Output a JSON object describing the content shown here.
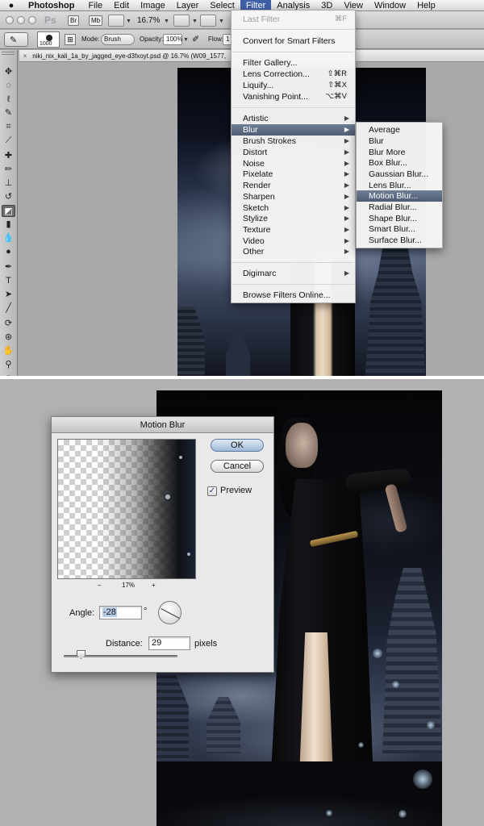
{
  "menubar": {
    "items": [
      "Photoshop",
      "File",
      "Edit",
      "Image",
      "Layer",
      "Select",
      "Filter",
      "Analysis",
      "3D",
      "View",
      "Window",
      "Help"
    ]
  },
  "appbar": {
    "logo": "Ps",
    "bridge": "Br",
    "minibridge": "Mb",
    "zoom": "16.7%"
  },
  "options": {
    "brush_size": "1000",
    "mode_label": "Mode:",
    "mode_value": "Brush",
    "opacity_label": "Opacity:",
    "opacity_value": "100%",
    "flow_label": "Flow:",
    "flow_value": "1"
  },
  "document_tab": {
    "close": "×",
    "title": "niki_nix_kali_1a_by_jagged_eye-d3fxoyt.psd @ 16.7% (W09_1577,"
  },
  "filter_menu": {
    "last_filter": "Last Filter",
    "last_filter_shortcut": "⌘F",
    "convert": "Convert for Smart Filters",
    "gallery": "Filter Gallery...",
    "lens_correction": "Lens Correction...",
    "lens_correction_shortcut": "⇧⌘R",
    "liquify": "Liquify...",
    "liquify_shortcut": "⇧⌘X",
    "vanishing_point": "Vanishing Point...",
    "vanishing_point_shortcut": "⌥⌘V",
    "categories": [
      "Artistic",
      "Blur",
      "Brush Strokes",
      "Distort",
      "Noise",
      "Pixelate",
      "Render",
      "Sharpen",
      "Sketch",
      "Stylize",
      "Texture",
      "Video",
      "Other"
    ],
    "digimarc": "Digimarc",
    "browse": "Browse Filters Online..."
  },
  "blur_submenu": {
    "items": [
      "Average",
      "Blur",
      "Blur More",
      "Box Blur...",
      "Gaussian Blur...",
      "Lens Blur...",
      "Motion Blur...",
      "Radial Blur...",
      "Shape Blur...",
      "Smart Blur...",
      "Surface Blur..."
    ],
    "highlighted_index": 6
  },
  "motion_blur": {
    "title": "Motion Blur",
    "ok": "OK",
    "cancel": "Cancel",
    "preview_label": "Preview",
    "preview_checked": true,
    "zoom_out": "–",
    "zoom_level": "17%",
    "zoom_in": "+",
    "angle_label": "Angle:",
    "angle_value": "-28",
    "degree_symbol": "°",
    "distance_label": "Distance:",
    "distance_value": "29",
    "distance_unit": "pixels"
  },
  "colors": {
    "menu_highlight": "#4f5c73",
    "menubar_active": "#3f5fa7"
  }
}
